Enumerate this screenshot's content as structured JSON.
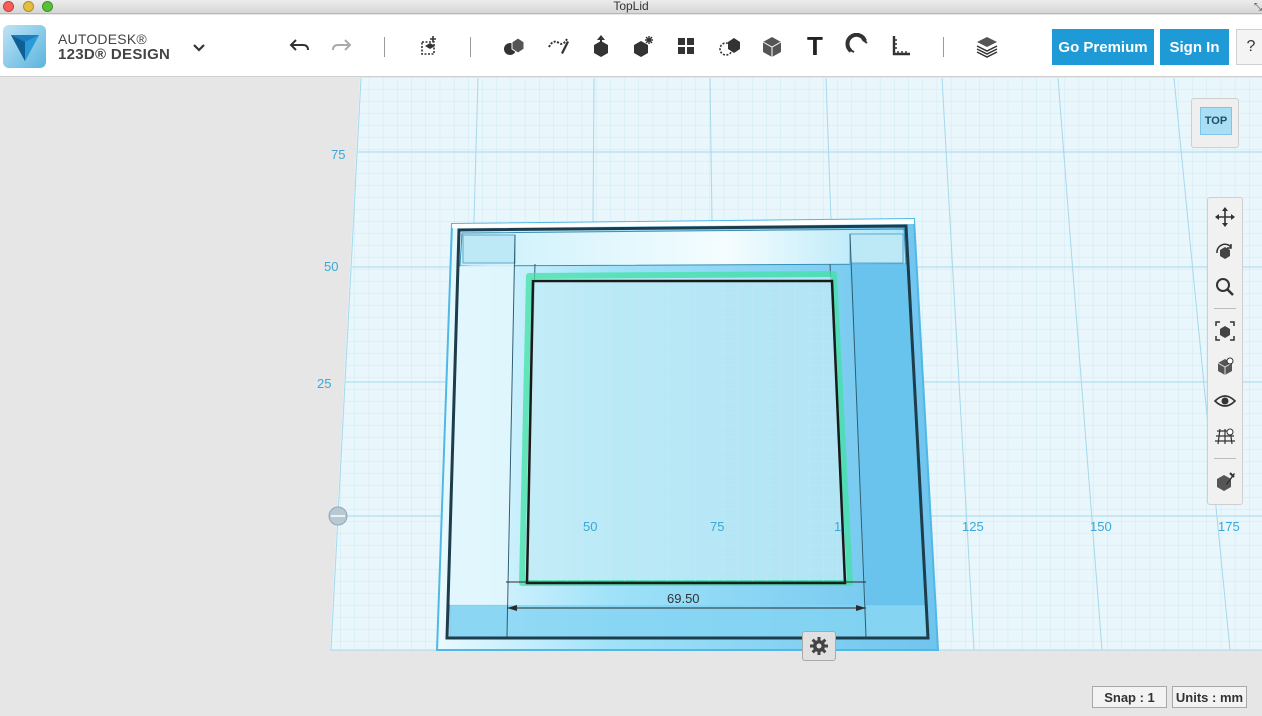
{
  "window": {
    "title": "TopLid"
  },
  "brand": {
    "line1": "AUTODESK®",
    "line2": "123D® DESIGN"
  },
  "toolbar": {
    "go_premium_label": "Go Premium",
    "sign_in_label": "Sign In",
    "help_label": "?",
    "text_tool_glyph": "T"
  },
  "viewport": {
    "axis_labels_x": [
      "50",
      "75",
      "1",
      "125",
      "150",
      "175"
    ],
    "axis_labels_y": [
      "75",
      "50",
      "25"
    ],
    "dimension_value": "69.50"
  },
  "viewcube": {
    "face_label": "TOP"
  },
  "status": {
    "snap": "Snap : 1",
    "units": "Units : mm"
  },
  "icons": {
    "toolbar": [
      "undo-icon",
      "redo-icon",
      "primitives-icon",
      "sketch-icon",
      "construct-icon",
      "modify-icon",
      "pattern-icon",
      "grouping-icon",
      "combine-icon",
      "measure-icon",
      "text-icon",
      "snap-icon",
      "ruler-icon",
      "layers-icon"
    ],
    "nav": [
      "pan-icon",
      "orbit-icon",
      "zoom-icon",
      "fit-icon",
      "view-cube-icon",
      "visibility-icon",
      "grid-icon",
      "material-icon"
    ]
  },
  "colors": {
    "accent": "#1e9ad6",
    "grid": "#c3e6f3",
    "grid_major": "#9fd3ea",
    "part": "#56c6ef",
    "selection": "#3fe3a8"
  }
}
